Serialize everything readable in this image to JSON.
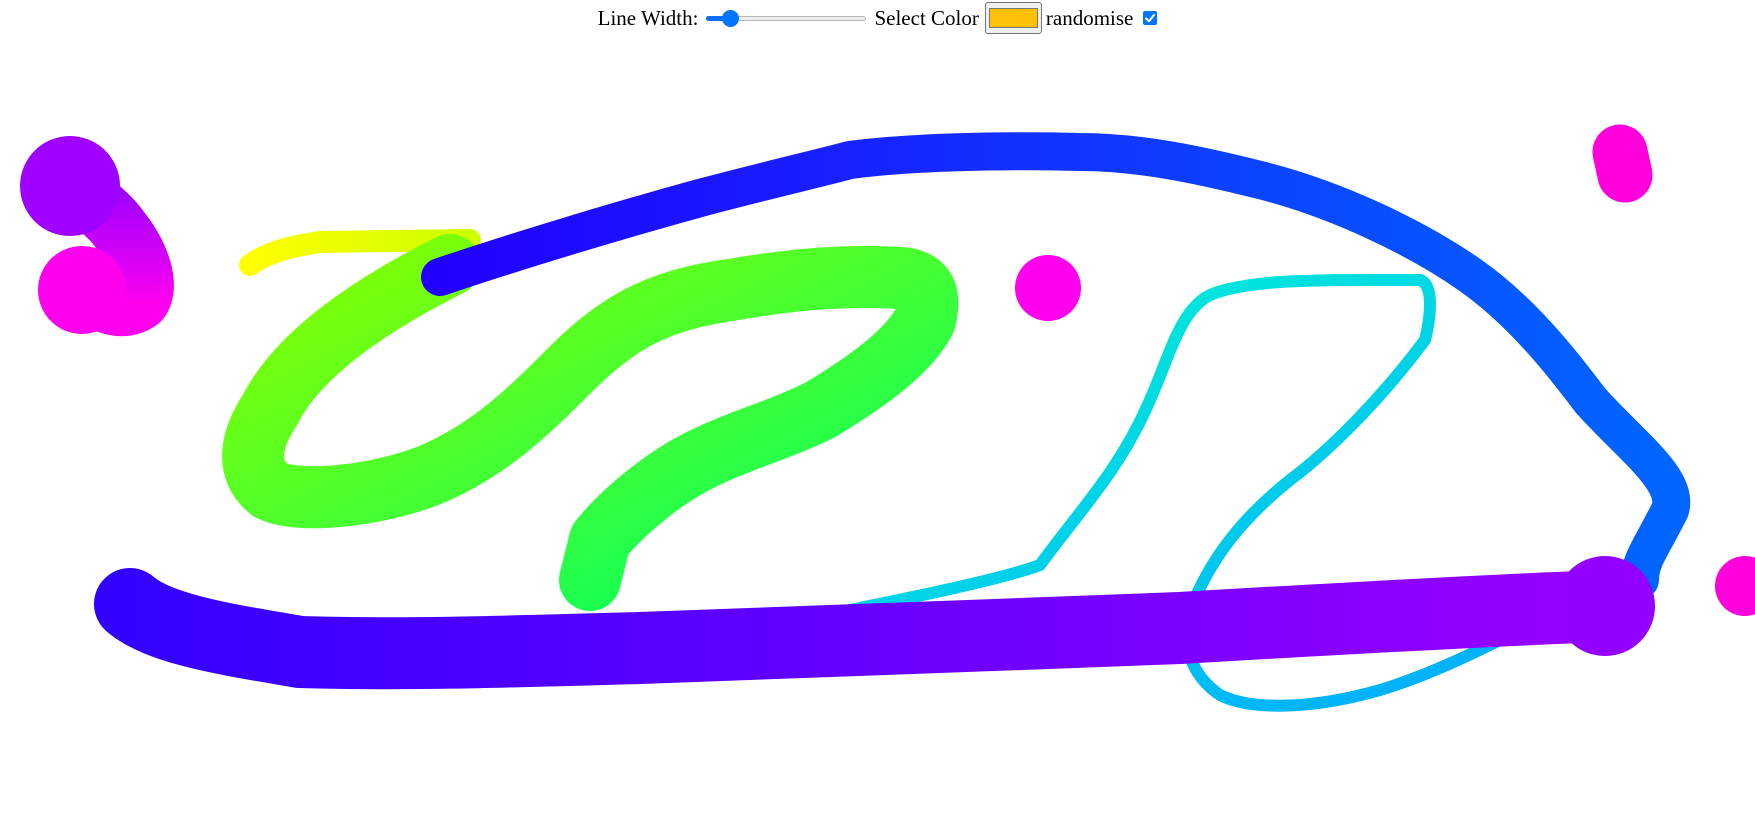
{
  "toolbar": {
    "line_width_label": "Line Width:",
    "line_width_value": 0.15,
    "select_color_label": "Select Color",
    "selected_color": "#ffc107",
    "randomise_label": "randomise",
    "randomise_checked": true
  },
  "accent_color": "#0075ff",
  "canvas": {
    "strokes": [
      {
        "id": "yellow-stroke",
        "color_start": "#ffff00",
        "color_end": "#ccff00"
      },
      {
        "id": "green-loop-stroke",
        "color_start": "#88ff00",
        "color_end": "#00ff66"
      },
      {
        "id": "cyan-stroke",
        "color_start": "#00ffcc",
        "color_end": "#00aaff"
      },
      {
        "id": "blue-arc-stroke",
        "color_start": "#2200ff",
        "color_end": "#0066ff"
      },
      {
        "id": "purple-bar-stroke",
        "color_start": "#3300ff",
        "color_end": "#9900ff"
      },
      {
        "id": "magenta-top-left-stroke",
        "color_start": "#9900ff",
        "color_end": "#ff00ee"
      },
      {
        "id": "magenta-dot-center",
        "color_start": "#ff00ee",
        "color_end": "#ff00ee"
      },
      {
        "id": "magenta-dot-top-right",
        "color_start": "#ff00dd",
        "color_end": "#ff00dd"
      },
      {
        "id": "magenta-dot-right-edge",
        "color_start": "#ff00dd",
        "color_end": "#ff00dd"
      }
    ]
  }
}
